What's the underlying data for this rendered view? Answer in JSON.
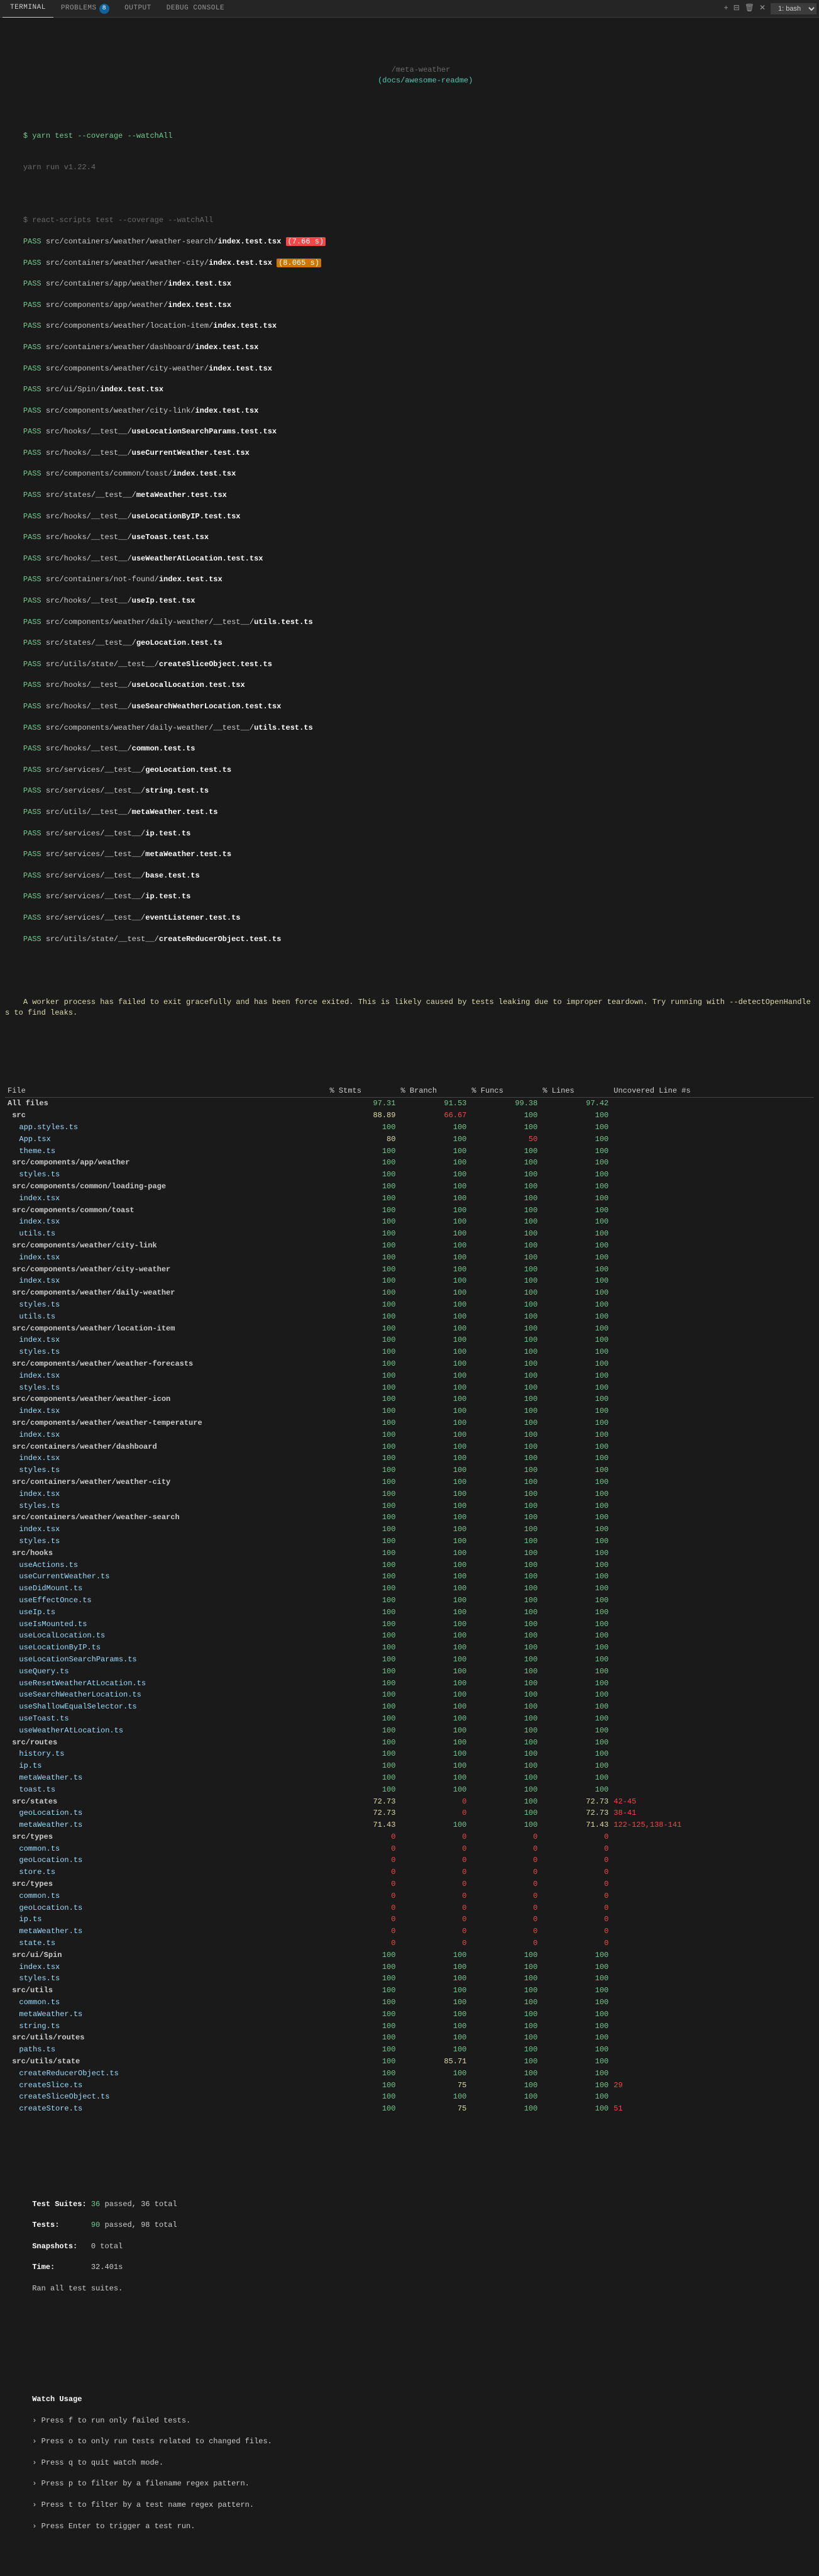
{
  "tabBar": {
    "tabs": [
      {
        "id": "terminal",
        "label": "TERMINAL",
        "active": true
      },
      {
        "id": "problems",
        "label": "PROBLEMS",
        "badge": "8",
        "active": false
      },
      {
        "id": "output",
        "label": "OUTPUT",
        "active": false
      },
      {
        "id": "debug-console",
        "label": "DEBUG CONSOLE",
        "active": false
      }
    ],
    "bash_label": "1: bash"
  },
  "title": "/meta-weather",
  "title_link": "(docs/awesome-readme)",
  "command_prompt": "$ yarn test --coverage --watchAll",
  "yarn_version": "yarn run v1.22.4",
  "pass_lines": [
    "$ react-scripts test --coverage --watchAll",
    "src/containers/weather/weather-search/index.test.tsx",
    "src/containers/weather/weather-city/index.test.tsx",
    "src/containers/app/weather/index.test.tsx",
    "src/components/app/weather/index.test.tsx",
    "src/components/weather/location-item/index.test.tsx",
    "src/containers/weather/dashboard/index.test.tsx",
    "src/components/weather/city-weather/index.test.tsx",
    "src/ui/Spin/index.test.tsx",
    "src/components/weather/city-link/index.test.tsx",
    "src/hooks/__test__/useLocationSearchParams.test.tsx",
    "src/hooks/__test__/useCurrentWeather.test.tsx",
    "src/components/common/toast/index.test.tsx",
    "src/states/__test__/metaWeather.test.tsx",
    "src/hooks/__test__/useLocationByIP.test.tsx",
    "src/hooks/__test__/useToast.test.tsx",
    "src/hooks/__test__/useWeatherAtLocation.test.tsx",
    "src/containers/not-found/index.test.tsx",
    "src/hooks/__test__/useIp.test.tsx",
    "src/components/weather/daily-weather/__test__/utils.test.ts",
    "src/states/__test__/geoLocation.test.ts",
    "src/utils/state/__test__/createSliceObject.test.ts",
    "src/hooks/__test__/useLocalLocation.test.tsx",
    "src/hooks/__test__/useSearchWeatherLocation.test.tsx",
    "src/components/weather/daily-weather/__test__/utils.test.ts",
    "src/hooks/__test__/common.test.ts",
    "src/services/__test__/geoLocation.test.ts",
    "src/services/__test__/string.test.ts",
    "src/utils/__test__/metaWeather.test.ts",
    "src/services/__test__/ip.test.ts",
    "src/services/__test__/metaWeather.test.ts",
    "src/services/__test__/base.test.ts",
    "src/services/__test__/ip.test.ts",
    "src/services/__test__/eventListener.test.ts",
    "src/utils/state/__test__/createReducerObject.test.ts"
  ],
  "worker_warning": "A worker process has failed to exit gracefully and has been force exited. This is likely caused by tests leaking due to improper teardown. Try running with --detectOpenHandles to find leaks.",
  "coverage_headers": [
    "File",
    "% Stmts",
    "% Branch",
    "% Funcs",
    "% Lines",
    "Uncovered Line #s"
  ],
  "all_files_row": {
    "stmts": "97.31",
    "branch": "91.53",
    "funcs": "99.38",
    "lines": "97.42"
  },
  "summary_row": {
    "stmts": "88.89",
    "branch": "66.67",
    "funcs": "100",
    "lines": "100"
  },
  "coverage_rows": [
    {
      "file": "app.styles.ts",
      "stmts": "100",
      "branch": "100",
      "funcs": "100",
      "lines": "100",
      "uncovered": "",
      "indent": true
    },
    {
      "file": "App.tsx",
      "stmts": "80",
      "branch": "100",
      "funcs": "50",
      "lines": "100",
      "uncovered": "",
      "indent": true
    },
    {
      "file": "theme.ts",
      "stmts": "100",
      "branch": "100",
      "funcs": "100",
      "lines": "100",
      "uncovered": "",
      "indent": true
    },
    {
      "file": "src/components/app/weather",
      "stmts": "100",
      "branch": "100",
      "funcs": "100",
      "lines": "100",
      "uncovered": "",
      "indent": false,
      "section": true
    },
    {
      "file": "styles.ts",
      "stmts": "100",
      "branch": "100",
      "funcs": "100",
      "lines": "100",
      "uncovered": "",
      "indent": true
    },
    {
      "file": "src/components/common/loading-page",
      "stmts": "100",
      "branch": "100",
      "funcs": "100",
      "lines": "100",
      "uncovered": "",
      "indent": false,
      "section": true
    },
    {
      "file": "index.tsx",
      "stmts": "100",
      "branch": "100",
      "funcs": "100",
      "lines": "100",
      "uncovered": "",
      "indent": true
    },
    {
      "file": "src/components/common/toast",
      "stmts": "100",
      "branch": "100",
      "funcs": "100",
      "lines": "100",
      "uncovered": "",
      "indent": false,
      "section": true
    },
    {
      "file": "index.tsx",
      "stmts": "100",
      "branch": "100",
      "funcs": "100",
      "lines": "100",
      "uncovered": "",
      "indent": true
    },
    {
      "file": "utils.ts",
      "stmts": "100",
      "branch": "100",
      "funcs": "100",
      "lines": "100",
      "uncovered": "",
      "indent": true
    },
    {
      "file": "src/components/weather/city-link",
      "stmts": "100",
      "branch": "100",
      "funcs": "100",
      "lines": "100",
      "uncovered": "",
      "indent": false,
      "section": true
    },
    {
      "file": "index.tsx",
      "stmts": "100",
      "branch": "100",
      "funcs": "100",
      "lines": "100",
      "uncovered": "",
      "indent": true
    },
    {
      "file": "src/components/weather/city-weather",
      "stmts": "100",
      "branch": "100",
      "funcs": "100",
      "lines": "100",
      "uncovered": "",
      "indent": false,
      "section": true
    },
    {
      "file": "index.tsx",
      "stmts": "100",
      "branch": "100",
      "funcs": "100",
      "lines": "100",
      "uncovered": "",
      "indent": true
    },
    {
      "file": "src/components/weather/daily-weather",
      "stmts": "100",
      "branch": "100",
      "funcs": "100",
      "lines": "100",
      "uncovered": "",
      "indent": false,
      "section": true
    },
    {
      "file": "styles.ts",
      "stmts": "100",
      "branch": "100",
      "funcs": "100",
      "lines": "100",
      "uncovered": "",
      "indent": true
    },
    {
      "file": "utils.ts",
      "stmts": "100",
      "branch": "100",
      "funcs": "100",
      "lines": "100",
      "uncovered": "",
      "indent": true
    },
    {
      "file": "src/components/weather/location-item",
      "stmts": "100",
      "branch": "100",
      "funcs": "100",
      "lines": "100",
      "uncovered": "",
      "indent": false,
      "section": true
    },
    {
      "file": "index.tsx",
      "stmts": "100",
      "branch": "100",
      "funcs": "100",
      "lines": "100",
      "uncovered": "",
      "indent": true
    },
    {
      "file": "styles.ts",
      "stmts": "100",
      "branch": "100",
      "funcs": "100",
      "lines": "100",
      "uncovered": "",
      "indent": true
    },
    {
      "file": "src/components/weather/weather-forecasts",
      "stmts": "100",
      "branch": "100",
      "funcs": "100",
      "lines": "100",
      "uncovered": "",
      "indent": false,
      "section": true
    },
    {
      "file": "index.tsx",
      "stmts": "100",
      "branch": "100",
      "funcs": "100",
      "lines": "100",
      "uncovered": "",
      "indent": true
    },
    {
      "file": "styles.ts",
      "stmts": "100",
      "branch": "100",
      "funcs": "100",
      "lines": "100",
      "uncovered": "",
      "indent": true
    },
    {
      "file": "src/components/weather/weather-icon",
      "stmts": "100",
      "branch": "100",
      "funcs": "100",
      "lines": "100",
      "uncovered": "",
      "indent": false,
      "section": true
    },
    {
      "file": "index.tsx",
      "stmts": "100",
      "branch": "100",
      "funcs": "100",
      "lines": "100",
      "uncovered": "",
      "indent": true
    },
    {
      "file": "src/components/weather/weather-temperature",
      "stmts": "100",
      "branch": "100",
      "funcs": "100",
      "lines": "100",
      "uncovered": "",
      "indent": false,
      "section": true
    },
    {
      "file": "index.tsx",
      "stmts": "100",
      "branch": "100",
      "funcs": "100",
      "lines": "100",
      "uncovered": "",
      "indent": true
    },
    {
      "file": "src/containers/weather/dashboard",
      "stmts": "100",
      "branch": "100",
      "funcs": "100",
      "lines": "100",
      "uncovered": "",
      "indent": false,
      "section": true
    },
    {
      "file": "index.tsx",
      "stmts": "100",
      "branch": "100",
      "funcs": "100",
      "lines": "100",
      "uncovered": "",
      "indent": true
    },
    {
      "file": "styles.ts",
      "stmts": "100",
      "branch": "100",
      "funcs": "100",
      "lines": "100",
      "uncovered": "",
      "indent": true
    },
    {
      "file": "src/containers/weather/weather-city",
      "stmts": "100",
      "branch": "100",
      "funcs": "100",
      "lines": "100",
      "uncovered": "",
      "indent": false,
      "section": true
    },
    {
      "file": "index.tsx",
      "stmts": "100",
      "branch": "100",
      "funcs": "100",
      "lines": "100",
      "uncovered": "",
      "indent": true
    },
    {
      "file": "styles.ts",
      "stmts": "100",
      "branch": "100",
      "funcs": "100",
      "lines": "100",
      "uncovered": "",
      "indent": true
    },
    {
      "file": "src/containers/weather/weather-search",
      "stmts": "100",
      "branch": "100",
      "funcs": "100",
      "lines": "100",
      "uncovered": "",
      "indent": false,
      "section": true
    },
    {
      "file": "index.tsx",
      "stmts": "100",
      "branch": "100",
      "funcs": "100",
      "lines": "100",
      "uncovered": "",
      "indent": true
    },
    {
      "file": "styles.ts",
      "stmts": "100",
      "branch": "100",
      "funcs": "100",
      "lines": "100",
      "uncovered": "",
      "indent": true
    },
    {
      "file": "src/hooks",
      "stmts": "100",
      "branch": "100",
      "funcs": "100",
      "lines": "100",
      "uncovered": "",
      "indent": false,
      "section": true
    },
    {
      "file": "useActions.ts",
      "stmts": "100",
      "branch": "100",
      "funcs": "100",
      "lines": "100",
      "uncovered": "",
      "indent": true
    },
    {
      "file": "useCurrentWeather.ts",
      "stmts": "100",
      "branch": "100",
      "funcs": "100",
      "lines": "100",
      "uncovered": "",
      "indent": true
    },
    {
      "file": "useDidMount.ts",
      "stmts": "100",
      "branch": "100",
      "funcs": "100",
      "lines": "100",
      "uncovered": "",
      "indent": true
    },
    {
      "file": "useEffectOnce.ts",
      "stmts": "100",
      "branch": "100",
      "funcs": "100",
      "lines": "100",
      "uncovered": "",
      "indent": true
    },
    {
      "file": "useIp.ts",
      "stmts": "100",
      "branch": "100",
      "funcs": "100",
      "lines": "100",
      "uncovered": "",
      "indent": true
    },
    {
      "file": "useIsMounted.ts",
      "stmts": "100",
      "branch": "100",
      "funcs": "100",
      "lines": "100",
      "uncovered": "",
      "indent": true
    },
    {
      "file": "useLocalLocation.ts",
      "stmts": "100",
      "branch": "100",
      "funcs": "100",
      "lines": "100",
      "uncovered": "",
      "indent": true
    },
    {
      "file": "useLocationByIP.ts",
      "stmts": "100",
      "branch": "100",
      "funcs": "100",
      "lines": "100",
      "uncovered": "",
      "indent": true
    },
    {
      "file": "useLocationSearchParams.ts",
      "stmts": "100",
      "branch": "100",
      "funcs": "100",
      "lines": "100",
      "uncovered": "",
      "indent": true
    },
    {
      "file": "useQuery.ts",
      "stmts": "100",
      "branch": "100",
      "funcs": "100",
      "lines": "100",
      "uncovered": "",
      "indent": true
    },
    {
      "file": "useResetWeatherAtLocation.ts",
      "stmts": "100",
      "branch": "100",
      "funcs": "100",
      "lines": "100",
      "uncovered": "",
      "indent": true
    },
    {
      "file": "useSearchWeatherLocation.ts",
      "stmts": "100",
      "branch": "100",
      "funcs": "100",
      "lines": "100",
      "uncovered": "",
      "indent": true
    },
    {
      "file": "useShallowEqualSelector.ts",
      "stmts": "100",
      "branch": "100",
      "funcs": "100",
      "lines": "100",
      "uncovered": "",
      "indent": true
    },
    {
      "file": "useToast.ts",
      "stmts": "100",
      "branch": "100",
      "funcs": "100",
      "lines": "100",
      "uncovered": "",
      "indent": true
    },
    {
      "file": "useWeatherAtLocation.ts",
      "stmts": "100",
      "branch": "100",
      "funcs": "100",
      "lines": "100",
      "uncovered": "",
      "indent": true
    },
    {
      "file": "src/routes",
      "stmts": "100",
      "branch": "100",
      "funcs": "100",
      "lines": "100",
      "uncovered": "",
      "indent": false,
      "section": true
    },
    {
      "file": "history.ts",
      "stmts": "100",
      "branch": "100",
      "funcs": "100",
      "lines": "100",
      "uncovered": "",
      "indent": true
    },
    {
      "file": "ip.ts",
      "stmts": "100",
      "branch": "100",
      "funcs": "100",
      "lines": "100",
      "uncovered": "",
      "indent": true
    },
    {
      "file": "metaWeather.ts",
      "stmts": "100",
      "branch": "100",
      "funcs": "100",
      "lines": "100",
      "uncovered": "",
      "indent": true
    },
    {
      "file": "toast.ts",
      "stmts": "100",
      "branch": "100",
      "funcs": "100",
      "lines": "100",
      "uncovered": "",
      "indent": true
    },
    {
      "file": "src/states",
      "stmts": "72.73",
      "branch": "0",
      "funcs": "100",
      "lines": "72.73",
      "uncovered": "42-45",
      "indent": false,
      "section": true,
      "bad_branch": true
    },
    {
      "file": "geoLocation.ts",
      "stmts": "72.73",
      "branch": "0",
      "funcs": "100",
      "lines": "72.73",
      "uncovered": "38-41",
      "indent": true,
      "bad_branch": true
    },
    {
      "file": "metaWeather.ts",
      "stmts": "71.43",
      "branch": "100",
      "funcs": "100",
      "lines": "71.43",
      "uncovered": "122-125,138-141",
      "indent": true
    },
    {
      "file": "src/types",
      "stmts": "0",
      "branch": "0",
      "funcs": "0",
      "lines": "0",
      "uncovered": "",
      "indent": false,
      "section": true
    },
    {
      "file": "common.ts",
      "stmts": "0",
      "branch": "0",
      "funcs": "0",
      "lines": "0",
      "uncovered": "",
      "indent": true
    },
    {
      "file": "geoLocation.ts",
      "stmts": "0",
      "branch": "0",
      "funcs": "0",
      "lines": "0",
      "uncovered": "",
      "indent": true
    },
    {
      "file": "store.ts",
      "stmts": "0",
      "branch": "0",
      "funcs": "0",
      "lines": "0",
      "uncovered": "",
      "indent": true
    },
    {
      "file": "src/types",
      "stmts": "0",
      "branch": "0",
      "funcs": "0",
      "lines": "0",
      "uncovered": "",
      "indent": false,
      "section": true
    },
    {
      "file": "common.ts",
      "stmts": "0",
      "branch": "0",
      "funcs": "0",
      "lines": "0",
      "uncovered": "",
      "indent": true
    },
    {
      "file": "geoLocation.ts",
      "stmts": "0",
      "branch": "0",
      "funcs": "0",
      "lines": "0",
      "uncovered": "",
      "indent": true
    },
    {
      "file": "ip.ts",
      "stmts": "0",
      "branch": "0",
      "funcs": "0",
      "lines": "0",
      "uncovered": "",
      "indent": true
    },
    {
      "file": "metaWeather.ts",
      "stmts": "0",
      "branch": "0",
      "funcs": "0",
      "lines": "0",
      "uncovered": "",
      "indent": true
    },
    {
      "file": "state.ts",
      "stmts": "0",
      "branch": "0",
      "funcs": "0",
      "lines": "0",
      "uncovered": "",
      "indent": true
    },
    {
      "file": "src/ui/Spin",
      "stmts": "100",
      "branch": "100",
      "funcs": "100",
      "lines": "100",
      "uncovered": "",
      "indent": false,
      "section": true
    },
    {
      "file": "index.tsx",
      "stmts": "100",
      "branch": "100",
      "funcs": "100",
      "lines": "100",
      "uncovered": "",
      "indent": true
    },
    {
      "file": "styles.ts",
      "stmts": "100",
      "branch": "100",
      "funcs": "100",
      "lines": "100",
      "uncovered": "",
      "indent": true
    },
    {
      "file": "src/utils",
      "stmts": "100",
      "branch": "100",
      "funcs": "100",
      "lines": "100",
      "uncovered": "",
      "indent": false,
      "section": true
    },
    {
      "file": "common.ts",
      "stmts": "100",
      "branch": "100",
      "funcs": "100",
      "lines": "100",
      "uncovered": "",
      "indent": true
    },
    {
      "file": "metaWeather.ts",
      "stmts": "100",
      "branch": "100",
      "funcs": "100",
      "lines": "100",
      "uncovered": "",
      "indent": true
    },
    {
      "file": "string.ts",
      "stmts": "100",
      "branch": "100",
      "funcs": "100",
      "lines": "100",
      "uncovered": "",
      "indent": true
    },
    {
      "file": "src/utils/routes",
      "stmts": "100",
      "branch": "100",
      "funcs": "100",
      "lines": "100",
      "uncovered": "",
      "indent": false,
      "section": true
    },
    {
      "file": "paths.ts",
      "stmts": "100",
      "branch": "100",
      "funcs": "100",
      "lines": "100",
      "uncovered": "",
      "indent": true
    },
    {
      "file": "src/utils/state",
      "stmts": "100",
      "branch": "85.71",
      "funcs": "100",
      "lines": "100",
      "uncovered": "",
      "indent": false,
      "section": true
    },
    {
      "file": "createReducerObject.ts",
      "stmts": "100",
      "branch": "100",
      "funcs": "100",
      "lines": "100",
      "uncovered": "",
      "indent": true
    },
    {
      "file": "createSlice.ts",
      "stmts": "100",
      "branch": "75",
      "funcs": "100",
      "lines": "100",
      "uncovered": "29",
      "indent": true
    },
    {
      "file": "createSliceObject.ts",
      "stmts": "100",
      "branch": "100",
      "funcs": "100",
      "lines": "100",
      "uncovered": "",
      "indent": true
    },
    {
      "file": "createStore.ts",
      "stmts": "100",
      "branch": "75",
      "funcs": "100",
      "lines": "100",
      "uncovered": "51",
      "indent": true
    }
  ],
  "test_summary": {
    "suites_passed": "36",
    "suites_total": "36",
    "tests_passed": "90",
    "tests_total": "98",
    "snapshots": "0",
    "time": "32.401"
  },
  "watch_usage": {
    "title": "Watch Usage",
    "options": [
      "› Press f to run only failed tests.",
      "› Press o to only run tests related to changed files.",
      "› Press q to quit watch mode.",
      "› Press p to filter by a filename regex pattern.",
      "› Press t to filter by a test name regex pattern.",
      "› Press Enter to trigger a test run."
    ]
  },
  "timing": {
    "search_red": "7.66 s",
    "city_orange": "8.065 s"
  }
}
